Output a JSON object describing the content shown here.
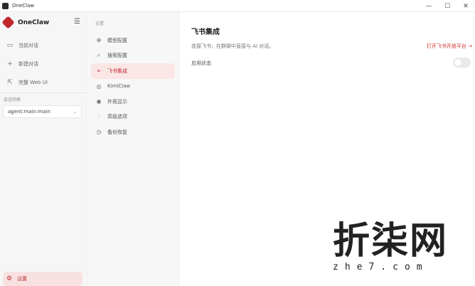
{
  "window": {
    "title": "OneClaw",
    "controls": {
      "minimize": "—",
      "maximize": "☐",
      "close": "✕"
    }
  },
  "sidebar": {
    "brand": {
      "name": "OneClaw",
      "logo_color": "#c0272d"
    },
    "menu_icon": "☰",
    "items": [
      {
        "label": "当前对话",
        "icon": "chat-icon",
        "glyph": "▭"
      },
      {
        "label": "新建对话",
        "icon": "plus-icon",
        "glyph": "+"
      },
      {
        "label": "完整 Web UI",
        "icon": "external-link-icon",
        "glyph": "⇱"
      }
    ],
    "section_label": "会话列表",
    "agent_select": {
      "value": "agent:main:main",
      "chevron": "⌄"
    },
    "settings": {
      "label": "设置",
      "icon": "gear-icon",
      "glyph": "⚙"
    }
  },
  "settings_nav": {
    "heading": "设置",
    "items": [
      {
        "label": "模型配置",
        "icon": "model-icon",
        "glyph": "⊕",
        "active": false
      },
      {
        "label": "搜索配置",
        "icon": "search-icon",
        "glyph": "⌕",
        "active": false
      },
      {
        "label": "飞书集成",
        "icon": "send-icon",
        "glyph": "➢",
        "active": true
      },
      {
        "label": "KimiClaw",
        "icon": "kimi-icon",
        "glyph": "◎",
        "active": false
      },
      {
        "label": "外观显示",
        "icon": "eye-icon",
        "glyph": "◉",
        "active": false
      },
      {
        "label": "高级选项",
        "icon": "sliders-icon",
        "glyph": "⫶",
        "active": false
      },
      {
        "label": "备份恢复",
        "icon": "history-icon",
        "glyph": "◷",
        "active": false
      }
    ]
  },
  "main": {
    "title": "飞书集成",
    "description": "连接飞书，在群聊中直接与 AI 对话。",
    "open_link": "打开飞书开放平台 →",
    "enable_label": "启用状态",
    "enabled": false
  },
  "watermark": {
    "cn": "折柒网",
    "en": "zhe7.com"
  },
  "colors": {
    "accent": "#c0272d",
    "active_bg": "#fbe6e6"
  }
}
